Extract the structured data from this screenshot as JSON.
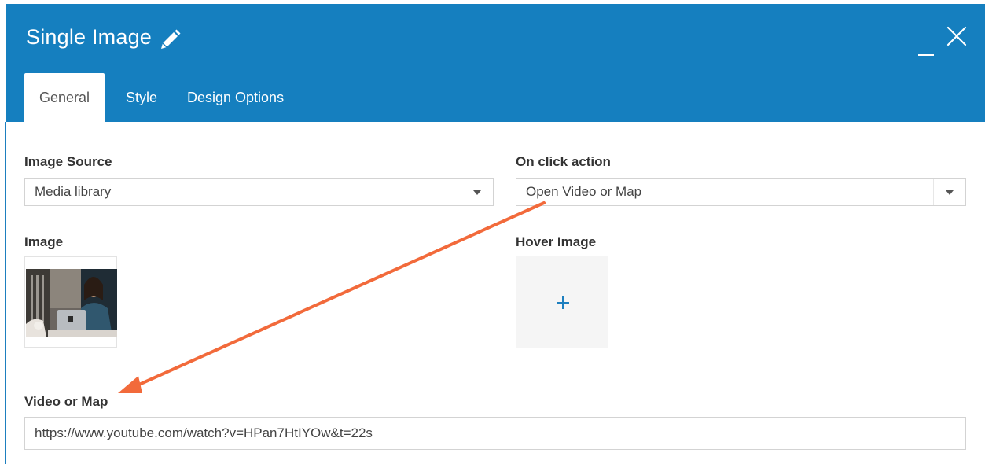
{
  "header": {
    "title": "Single Image",
    "icons": {
      "edit": "pencil-icon",
      "minimize": "minimize-icon",
      "close": "close-icon"
    },
    "background": "#157fbf"
  },
  "tabs": [
    {
      "label": "General",
      "active": true
    },
    {
      "label": "Style",
      "active": false
    },
    {
      "label": "Design Options",
      "active": false
    }
  ],
  "fields": {
    "image_source": {
      "label": "Image Source",
      "value": "Media library"
    },
    "on_click_action": {
      "label": "On click action",
      "value": "Open Video or Map"
    },
    "image": {
      "label": "Image"
    },
    "hover_image": {
      "label": "Hover Image",
      "add_icon": "plus-icon"
    },
    "video_or_map": {
      "label": "Video or Map",
      "value": "https://www.youtube.com/watch?v=HPan7HtIYOw&t=22s"
    }
  },
  "annotation": {
    "color": "#f26a3b"
  },
  "colors": {
    "accent": "#157fbf",
    "plus": "#1d7fbf"
  }
}
